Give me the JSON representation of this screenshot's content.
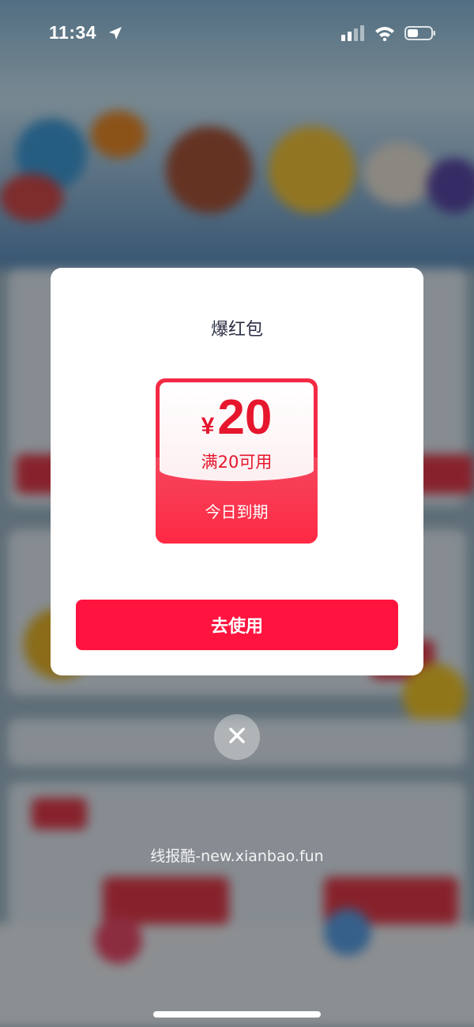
{
  "status_bar": {
    "time": "11:34"
  },
  "modal": {
    "title": "爆红包",
    "coupon": {
      "currency": "¥",
      "amount": "20",
      "threshold": "满20可用",
      "expiry": "今日到期"
    },
    "use_button_label": "去使用"
  },
  "watermark": "线报酷-new.xianbao.fun",
  "colors": {
    "accent": "#ff1440",
    "coupon_red": "#f32a45",
    "title_text": "#2b2f45"
  }
}
